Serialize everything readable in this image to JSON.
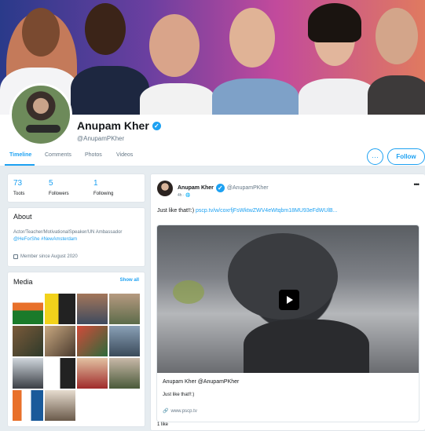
{
  "profile": {
    "name": "Anupam Kher",
    "handle": "@AnupamPKher"
  },
  "tabs": [
    {
      "label": "Timeline",
      "active": true
    },
    {
      "label": "Comments",
      "active": false
    },
    {
      "label": "Photos",
      "active": false
    },
    {
      "label": "Videos",
      "active": false
    }
  ],
  "actions": {
    "more": "···",
    "follow": "Follow"
  },
  "stats": [
    {
      "value": "73",
      "label": "Toots"
    },
    {
      "value": "5",
      "label": "Followers"
    },
    {
      "value": "1",
      "label": "Following"
    }
  ],
  "about": {
    "title": "About",
    "bio_plain": "Actor/Teacher/MotivationalSpeaker/UN Ambassador ",
    "bio_link1": "@HeForShe",
    "bio_link2": "#NewAmsterdam",
    "member_since": "Member since August 2020"
  },
  "media": {
    "title": "Media",
    "show_all": "Show all"
  },
  "post": {
    "author": "Anupam Kher",
    "handle": "@AnupamPKher",
    "sub": "4h · 🌐",
    "more": "•••",
    "text_plain": "Just like that!!:) ",
    "text_link": "pscp.tv/w/coxrfjFsWktwZWV4eWtqbm18MU93eFdWUlB...",
    "embed_title": "Anupam Kher @AnupamPKher",
    "embed_desc": "Just like that!!:)",
    "embed_url": "www.pscp.tv",
    "likes": "1 like"
  },
  "colors": {
    "accent": "#1da1f2",
    "background": "#e6ecf0"
  }
}
